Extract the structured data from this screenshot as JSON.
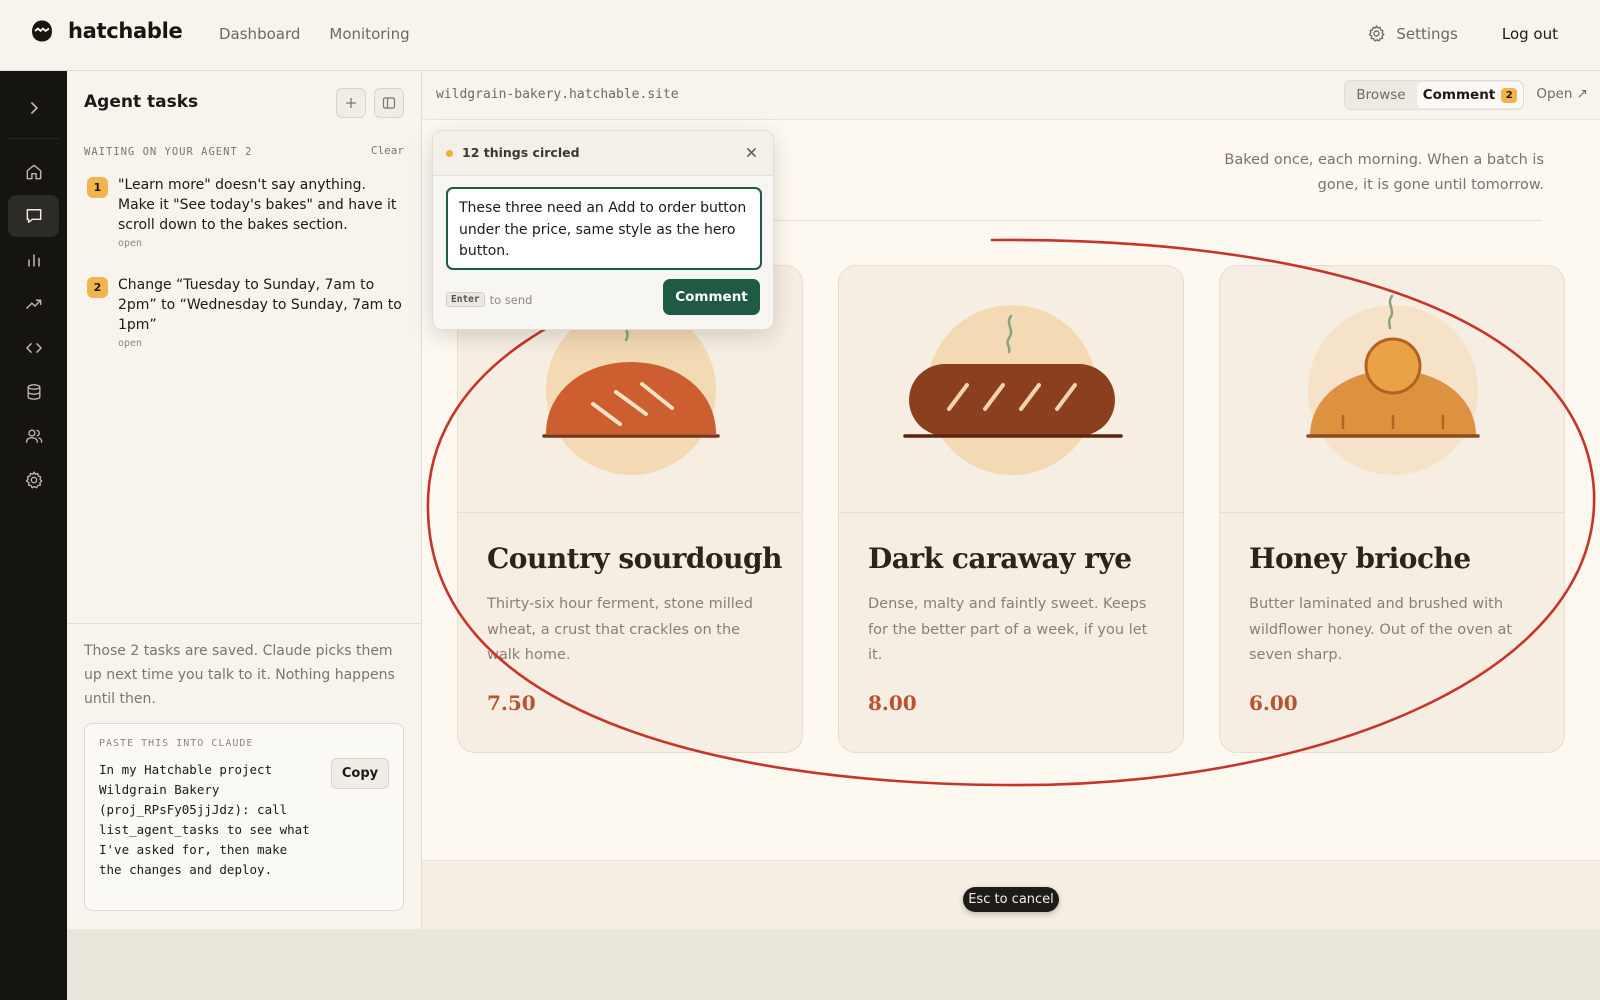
{
  "app": {
    "brand": "hatchable",
    "nav": [
      "Dashboard",
      "Monitoring"
    ],
    "settings_label": "Settings",
    "logout_label": "Log out"
  },
  "rail": {
    "items": [
      "chevron-right-icon",
      "home-icon",
      "chat-icon",
      "bar-chart-icon",
      "trending-up-icon",
      "code-icon",
      "database-icon",
      "users-icon",
      "gear-icon"
    ],
    "active": "chat-icon"
  },
  "tasks_panel": {
    "title": "Agent tasks",
    "section_label": "WAITING ON YOUR AGENT 2",
    "clear_label": "Clear",
    "tasks": [
      {
        "num": "1",
        "text": "\"Learn more\" doesn't say anything. Make it \"See today's bakes\" and have it scroll down to the bakes section.",
        "status": "open"
      },
      {
        "num": "2",
        "text": "Change “Tuesday to Sunday, 7am to 2pm” to “Wednesday to Sunday, 7am to 1pm”",
        "status": "open"
      }
    ],
    "footer_note": "Those 2 tasks are saved. Claude picks them up next time you talk to it. Nothing happens until then.",
    "paste_label": "PASTE THIS INTO CLAUDE",
    "paste_text": "In my Hatchable project Wildgrain Bakery (proj_RPsFy05jjJdz): call list_agent_tasks to see what I've asked for, then make the changes and deploy.",
    "copy_label": "Copy"
  },
  "preview": {
    "url": "wildgrain-bakery.hatchable.site",
    "modes": {
      "browse": "Browse",
      "comment": "Comment",
      "comment_count": "2"
    },
    "open_label": "Open ↗",
    "blurb": "Baked once, each morning. When a batch is gone, it is gone until tomorrow.",
    "products": [
      {
        "name": "Country sourdough",
        "desc": "Thirty-six hour ferment, stone milled wheat, a crust that crackles on the walk home.",
        "price": "7.50"
      },
      {
        "name": "Dark caraway rye",
        "desc": "Dense, malty and faintly sweet. Keeps for the better part of a week, if you let it.",
        "price": "8.00"
      },
      {
        "name": "Honey brioche",
        "desc": "Butter laminated and brushed with wildflower honey. Out of the oven at seven sharp.",
        "price": "6.00"
      }
    ],
    "esc_hint": "Esc to cancel"
  },
  "comment_popover": {
    "title": "12 things circled",
    "input_value": "These three need an Add to order button under the price, same style as the hero button.",
    "enter_key": "Enter",
    "send_hint": "to send",
    "submit_label": "Comment"
  },
  "colors": {
    "accent_green": "#1f5b44",
    "badge_amber": "#f1b54b",
    "price_rust": "#b8532d",
    "annotation_red": "#c7342b",
    "rail_bg": "#151410"
  }
}
